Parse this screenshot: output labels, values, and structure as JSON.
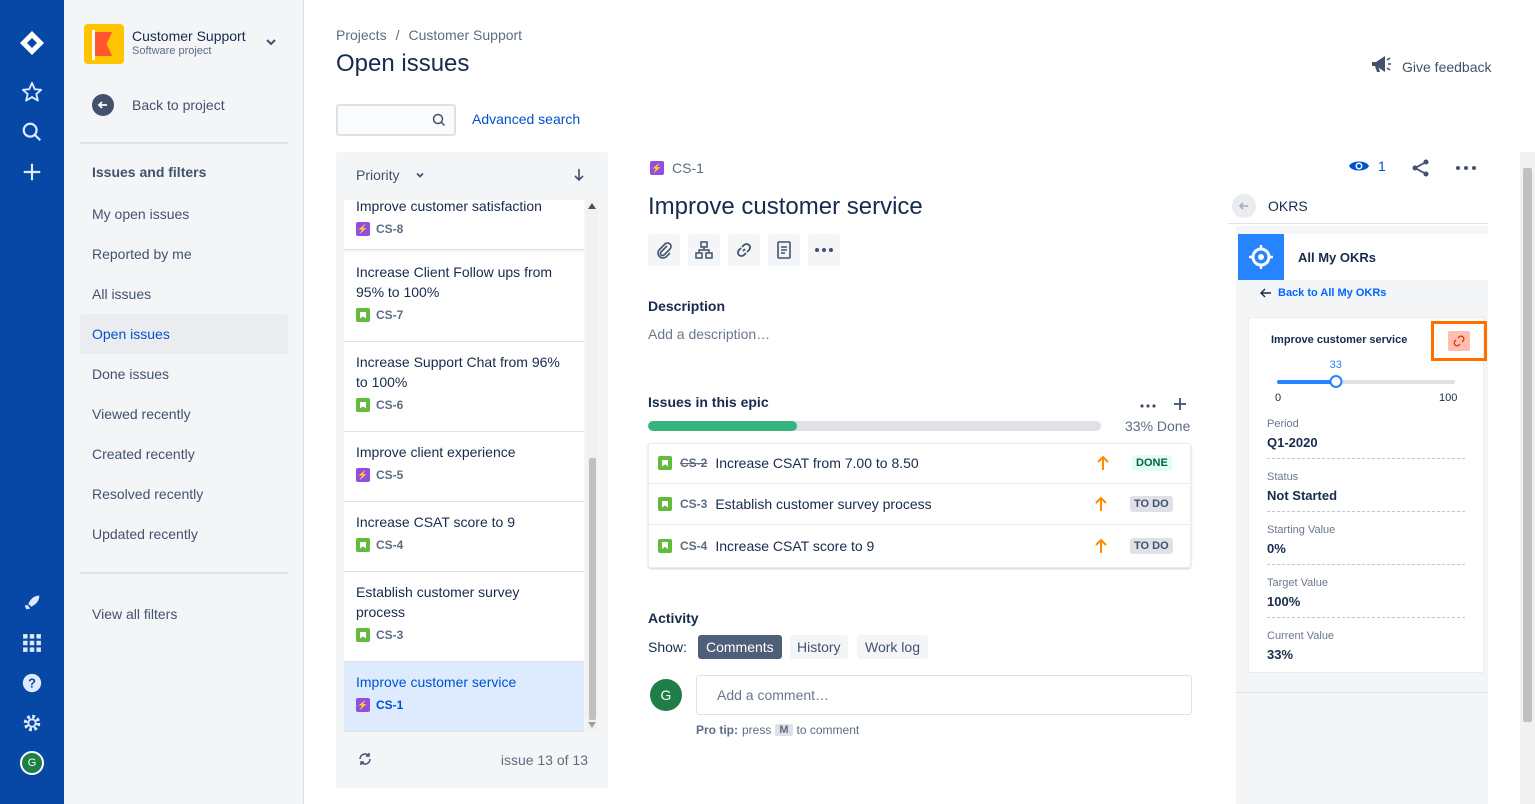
{
  "global_nav": {
    "avatar_initial": "G",
    "icons": [
      "jira-logo-icon",
      "star-icon",
      "search-icon",
      "plus-icon",
      "rocket-icon",
      "apps-grid-icon",
      "help-icon",
      "gear-icon"
    ]
  },
  "project": {
    "name": "Customer Support",
    "type": "Software project",
    "back_label": "Back to project"
  },
  "sidebar": {
    "section_title": "Issues and filters",
    "items": [
      {
        "label": "My open issues",
        "active": false
      },
      {
        "label": "Reported by me",
        "active": false
      },
      {
        "label": "All issues",
        "active": false
      },
      {
        "label": "Open issues",
        "active": true
      },
      {
        "label": "Done issues",
        "active": false
      },
      {
        "label": "Viewed recently",
        "active": false
      },
      {
        "label": "Created recently",
        "active": false
      },
      {
        "label": "Resolved recently",
        "active": false
      },
      {
        "label": "Updated recently",
        "active": false
      }
    ],
    "view_all": "View all filters"
  },
  "header": {
    "breadcrumb": [
      "Projects",
      "/",
      "Customer Support"
    ],
    "title": "Open issues",
    "feedback": "Give feedback",
    "search_placeholder": "",
    "advanced_search": "Advanced search"
  },
  "issue_list": {
    "sort_label": "Priority",
    "items": [
      {
        "title": "Improve customer satisfaction",
        "key": "CS-8",
        "type": "epic"
      },
      {
        "title": "Increase Client Follow ups from 95% to 100%",
        "key": "CS-7",
        "type": "story"
      },
      {
        "title": "Increase Support Chat from 96% to 100%",
        "key": "CS-6",
        "type": "story"
      },
      {
        "title": "Improve client experience",
        "key": "CS-5",
        "type": "epic"
      },
      {
        "title": "Increase CSAT score to 9",
        "key": "CS-4",
        "type": "story"
      },
      {
        "title": "Establish customer survey process",
        "key": "CS-3",
        "type": "story"
      },
      {
        "title": "Improve customer service",
        "key": "CS-1",
        "type": "epic",
        "selected": true
      }
    ],
    "footer_count": "issue 13 of 13"
  },
  "issue": {
    "key": "CS-1",
    "title": "Improve customer service",
    "watchers": "1",
    "description_heading": "Description",
    "description_placeholder": "Add a description…",
    "epic_heading": "Issues in this epic",
    "epic_progress_pct": 33,
    "epic_progress_label": "33% Done",
    "child_issues": [
      {
        "key": "CS-2",
        "title": "Increase CSAT from 7.00 to 8.50",
        "status": "DONE",
        "done": true
      },
      {
        "key": "CS-3",
        "title": "Establish customer survey process",
        "status": "TO DO",
        "done": false
      },
      {
        "key": "CS-4",
        "title": "Increase CSAT score to 9",
        "status": "TO DO",
        "done": false
      }
    ],
    "activity_heading": "Activity",
    "show_label": "Show:",
    "activity_tabs": [
      "Comments",
      "History",
      "Work log"
    ],
    "comment_placeholder": "Add a comment…",
    "commenter_initial": "G",
    "pro_tip_bold": "Pro tip:",
    "pro_tip_press": "press",
    "pro_tip_key": "M",
    "pro_tip_rest": "to comment"
  },
  "okr_panel": {
    "title": "OKRS",
    "header": "All My OKRs",
    "back_link": "Back to All My OKRs",
    "objective": "Improve customer service",
    "slider_value": 33,
    "slider_min": "0",
    "slider_max": "100",
    "fields": [
      {
        "label": "Period",
        "value": "Q1-2020"
      },
      {
        "label": "Status",
        "value": "Not Started"
      },
      {
        "label": "Starting Value",
        "value": "0%"
      },
      {
        "label": "Target Value",
        "value": "100%"
      },
      {
        "label": "Current Value",
        "value": "33%"
      }
    ]
  },
  "colors": {
    "nav_bg": "#0747a6",
    "link": "#0052cc",
    "progress": "#36b37e",
    "highlight_border": "#ff5630"
  }
}
